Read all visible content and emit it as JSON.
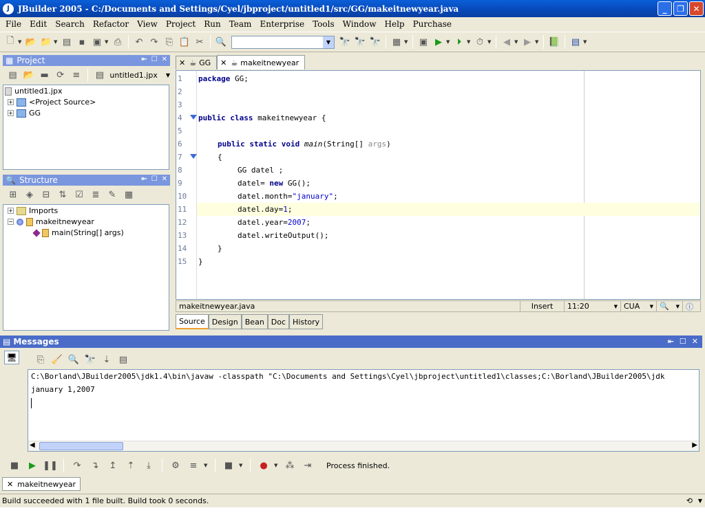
{
  "window": {
    "title": "JBuilder 2005 - C:/Documents and Settings/Cyel/jbproject/untitled1/src/GG/makeitnewyear.java",
    "app_icon": "J"
  },
  "menu": [
    "File",
    "Edit",
    "Search",
    "Refactor",
    "View",
    "Project",
    "Run",
    "Team",
    "Enterprise",
    "Tools",
    "Window",
    "Help",
    "Purchase"
  ],
  "project_panel": {
    "title": "Project",
    "project_combo": "untitled1.jpx",
    "tree": [
      {
        "label": "untitled1.jpx"
      },
      {
        "label": "<Project Source>"
      },
      {
        "label": "GG"
      }
    ]
  },
  "structure_panel": {
    "title": "Structure",
    "tree": [
      {
        "label": "Imports"
      },
      {
        "label": "makeitnewyear"
      },
      {
        "label": "main(String[] args)"
      }
    ]
  },
  "editor": {
    "tabs": [
      {
        "label": "GG"
      },
      {
        "label": "makeitnewyear"
      }
    ],
    "lines": [
      {
        "n": "1"
      },
      {
        "n": "2"
      },
      {
        "n": "3"
      },
      {
        "n": "4"
      },
      {
        "n": "5"
      },
      {
        "n": "6"
      },
      {
        "n": "7"
      },
      {
        "n": "8"
      },
      {
        "n": "9"
      },
      {
        "n": "10"
      },
      {
        "n": "11"
      },
      {
        "n": "12"
      },
      {
        "n": "13"
      },
      {
        "n": "14"
      },
      {
        "n": "15"
      }
    ],
    "code": {
      "l1_kw": "package",
      "l1_rest": " GG;",
      "l4_kw": "public class",
      "l4_rest": " makeitnewyear {",
      "l6_kw": "public static void",
      "l6_method": "main",
      "l6_type": "(String[] ",
      "l6_arg": "args",
      "l6_end": ")",
      "l7": "{",
      "l8": "GG datel ;",
      "l9_a": "datel= ",
      "l9_kw": "new",
      "l9_b": " GG();",
      "l10_a": "datel.month=",
      "l10_str": "\"january\"",
      "l10_b": ";",
      "l11_a": "datel.day=",
      "l11_num": "1",
      "l11_b": ";",
      "l12_a": "datel.year=",
      "l12_num": "2007",
      "l12_b": ";",
      "l13": "datel.writeOutput();",
      "l14": "}",
      "l15": "}"
    },
    "status": {
      "file": "makeitnewyear.java",
      "mode": "Insert",
      "position": "11:20",
      "keymap": "CUA"
    },
    "subtabs": [
      "Source",
      "Design",
      "Bean",
      "Doc",
      "History"
    ]
  },
  "messages": {
    "title": "Messages",
    "lines": [
      "C:\\Borland\\JBuilder2005\\jdk1.4\\bin\\javaw -classpath \"C:\\Documents and Settings\\Cyel\\jbproject\\untitled1\\classes;C:\\Borland\\JBuilder2005\\jdk",
      "january 1,2007"
    ],
    "process_status": "Process finished.",
    "bottom_tab": "makeitnewyear"
  },
  "statusbar": {
    "text": "Build succeeded with 1 file built.  Build took 0 seconds."
  }
}
